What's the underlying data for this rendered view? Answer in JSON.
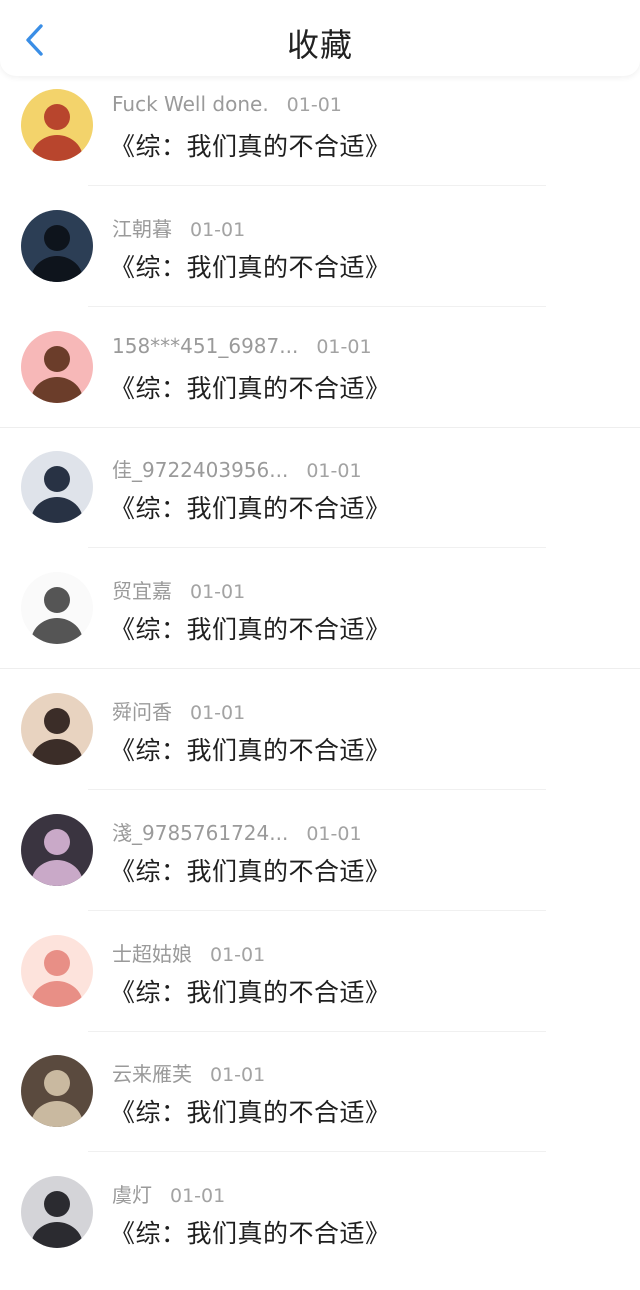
{
  "header": {
    "title": "收藏",
    "back_icon": "chevron-left-icon",
    "accent": "#3a8ee6"
  },
  "items": [
    {
      "name": "Fuck Well done.",
      "date": "01-01",
      "book": "《综：我们真的不合适》",
      "avatar": {
        "bg": "#f3d36b",
        "fg": "#b8452d"
      }
    },
    {
      "name": "江朝暮",
      "date": "01-01",
      "book": "《综：我们真的不合适》",
      "avatar": {
        "bg": "#2c3e55",
        "fg": "#0e141c"
      }
    },
    {
      "name": "158***451_6987...",
      "date": "01-01",
      "book": "《综：我们真的不合适》",
      "avatar": {
        "bg": "#f7b8b8",
        "fg": "#6b3d2a"
      }
    },
    {
      "name": "佳_9722403956...",
      "date": "01-01",
      "book": "《综：我们真的不合适》",
      "avatar": {
        "bg": "#dfe3ea",
        "fg": "#283244"
      }
    },
    {
      "name": "贸宜嘉",
      "date": "01-01",
      "book": "《综：我们真的不合适》",
      "avatar": {
        "bg": "#fafafa",
        "fg": "#555555"
      }
    },
    {
      "name": "舜问香",
      "date": "01-01",
      "book": "《综：我们真的不合适》",
      "avatar": {
        "bg": "#e8d3c0",
        "fg": "#3b2d28"
      }
    },
    {
      "name": "淺_9785761724...",
      "date": "01-01",
      "book": "《综：我们真的不合适》",
      "avatar": {
        "bg": "#3a3440",
        "fg": "#c9a9c8"
      }
    },
    {
      "name": "士超姑娘",
      "date": "01-01",
      "book": "《综：我们真的不合适》",
      "avatar": {
        "bg": "#fde3dc",
        "fg": "#e88f86"
      }
    },
    {
      "name": "云来雁芙",
      "date": "01-01",
      "book": "《综：我们真的不合适》",
      "avatar": {
        "bg": "#5a4a3e",
        "fg": "#c9b9a0"
      }
    },
    {
      "name": "虞灯",
      "date": "01-01",
      "book": "《综：我们真的不合适》",
      "avatar": {
        "bg": "#d4d4d8",
        "fg": "#2b2b30"
      }
    }
  ]
}
